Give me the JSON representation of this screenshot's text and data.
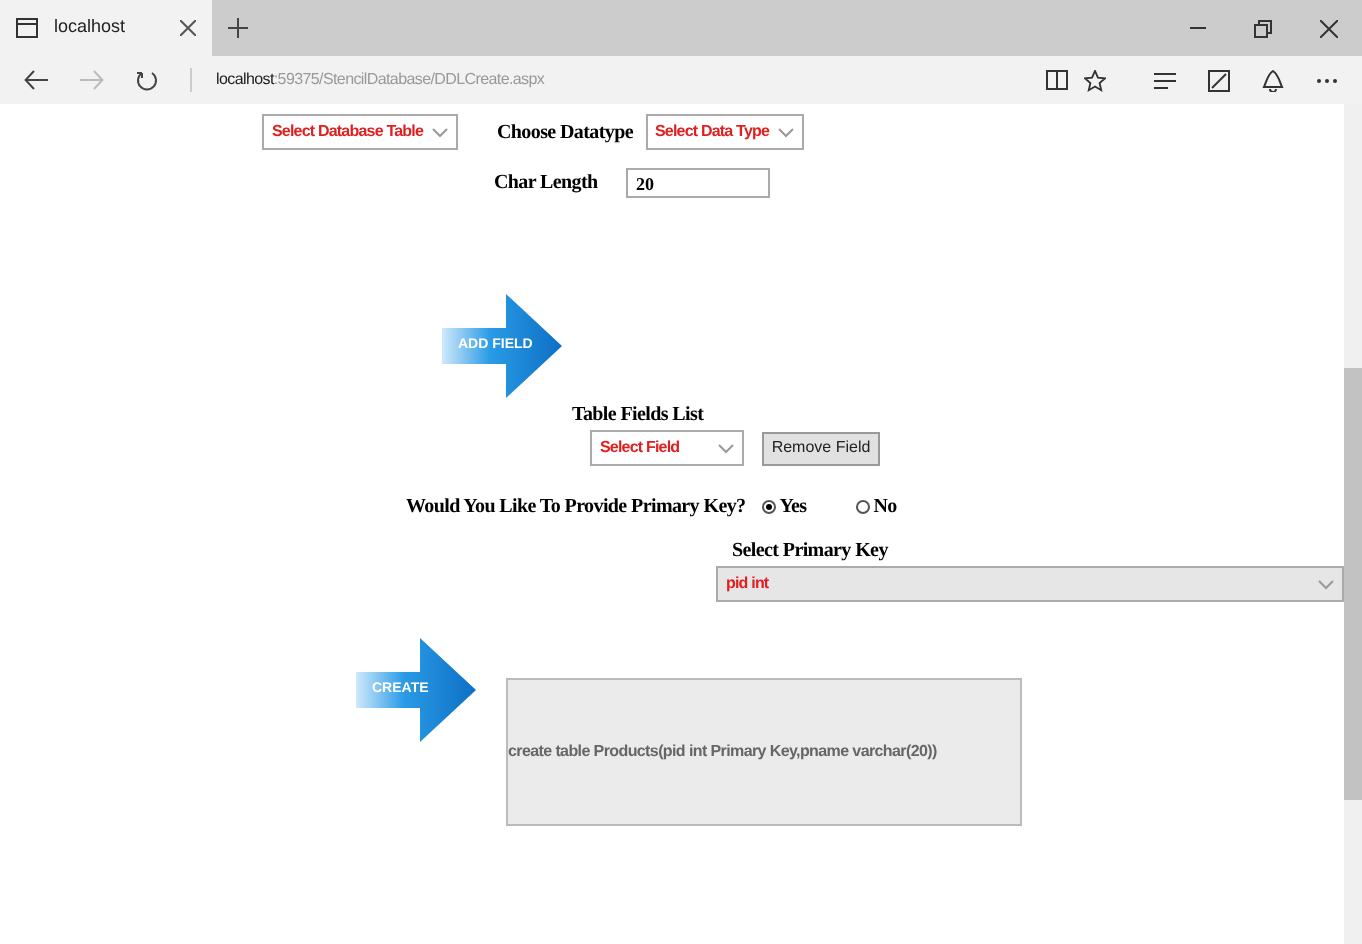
{
  "browser": {
    "tab_title": "localhost",
    "url_host": "localhost",
    "url_path": ":59375/StencilDatabase/DDLCreate.aspx"
  },
  "form": {
    "table_select": "Select Database Table",
    "datatype_label": "Choose Datatype",
    "datatype_select": "Select Data Type",
    "char_length_label": "Char Length",
    "char_length_value": "20",
    "add_field_button": "ADD FIELD",
    "fields_list_label": "Table Fields List",
    "field_select": "Select Field",
    "remove_button": "Remove Field",
    "primary_key_question": "Would You Like To Provide Primary Key?",
    "primary_key_options": [
      {
        "label": "Yes",
        "selected": true
      },
      {
        "label": "No",
        "selected": false
      }
    ],
    "primary_key_label": "Select Primary Key",
    "primary_key_select": "pid int",
    "create_button": "CREATE",
    "output": "create table Products(pid int Primary Key,pname varchar(20))"
  }
}
